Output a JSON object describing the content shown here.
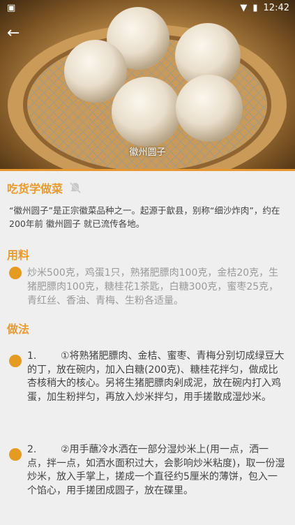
{
  "status_bar": {
    "time": "12:42"
  },
  "hero": {
    "caption": "徽州圆子"
  },
  "main": {
    "title": "吃货学做菜",
    "intro": "“徽州圆子”是正宗徽菜品种之一。起源于歙县，别称“细沙炸肉”，约在200年前 徽州圆子 就已流传各地。"
  },
  "ingredients": {
    "title": "用料",
    "text": "炒米500克，鸡蛋1只，熟猪肥膘肉100克，金桔20克，生猪肥膘肉100克，糖桂花1茶匙，白糖300克，蜜枣25克，青红丝、香油、青梅、生粉各适量。"
  },
  "steps": {
    "title": "做法",
    "items": [
      {
        "num": "1.",
        "text": "①将熟猪肥膘肉、金桔、蜜枣、青梅分别切成绿豆大的丁，放在碗内，加入白糖(200克)、糖桂花拌匀，做成比杏核稍大的核心。另将生猪肥膘肉剁成泥，放在碗内打入鸡蛋，加生粉拌匀，再放入炒米拌匀，用手搓散成湿炒米。"
      },
      {
        "num": "2.",
        "text": "②用手蘸冷水洒在一部分湿炒米上(用一点，洒一点，拌一点，如洒水面积过大，会影响炒米粘度)，取一份湿炒米，放入手掌上，搓成一个直径约5厘米的薄饼，包入一个馅心，用手搓团成圆子，放在碟里。"
      }
    ]
  },
  "colors": {
    "accent": "#e89b2d",
    "dot": "#e59a22",
    "background": "#efefef"
  }
}
